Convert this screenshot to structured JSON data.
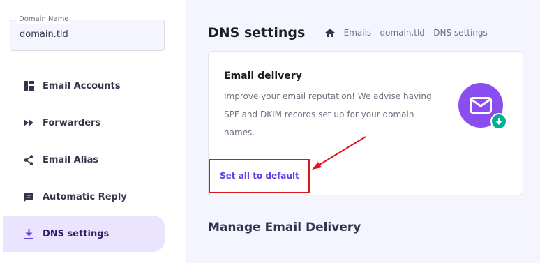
{
  "sidebar": {
    "domain": {
      "label": "Domain Name",
      "value": "domain.tld"
    },
    "items": [
      {
        "label": "Email Accounts",
        "icon": "dashboard-icon"
      },
      {
        "label": "Forwarders",
        "icon": "fast-forward-icon"
      },
      {
        "label": "Email Alias",
        "icon": "share-icon"
      },
      {
        "label": "Automatic Reply",
        "icon": "chat-icon"
      },
      {
        "label": "DNS settings",
        "icon": "download-icon",
        "active": true
      }
    ]
  },
  "header": {
    "title": "DNS settings",
    "breadcrumb": {
      "home_icon": "home-icon",
      "separator": "-",
      "items": [
        "Emails",
        "domain.tld",
        "DNS settings"
      ]
    }
  },
  "card": {
    "title": "Email delivery",
    "description": "Improve your email reputation! We advise having SPF and DKIM records set up for your domain names.",
    "action_label": "Set all to default",
    "illustration_icon": "envelope-icon",
    "badge_icon": "download-arrow-icon"
  },
  "section": {
    "title": "Manage Email Delivery"
  },
  "colors": {
    "accent": "#673de6",
    "active_bg": "#ebe4ff",
    "main_bg": "#f4f5ff",
    "illustration": "#8c4df0",
    "badge": "#00b090",
    "annotation": "#e0151c"
  }
}
